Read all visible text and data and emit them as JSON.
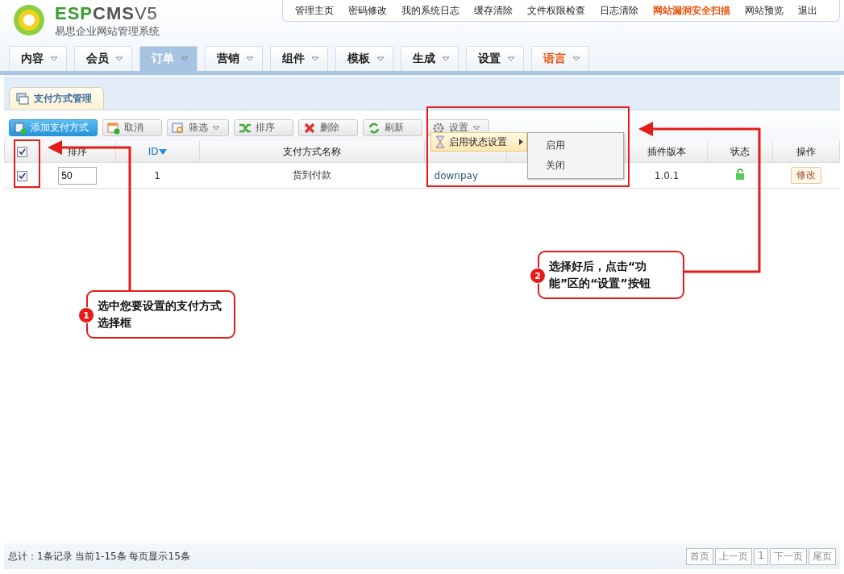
{
  "logo": {
    "wordmark_a": "ESP",
    "wordmark_b": "CMS",
    "version": "V5",
    "subtitle": "易思企业网站管理系统"
  },
  "top_links": [
    {
      "label": "管理主页",
      "highlight": false
    },
    {
      "label": "密码修改",
      "highlight": false
    },
    {
      "label": "我的系统日志",
      "highlight": false
    },
    {
      "label": "缓存清除",
      "highlight": false
    },
    {
      "label": "文件权限检查",
      "highlight": false
    },
    {
      "label": "日志清除",
      "highlight": false
    },
    {
      "label": "网站漏洞安全扫描",
      "highlight": true
    },
    {
      "label": "网站预览",
      "highlight": false
    },
    {
      "label": "退出",
      "highlight": false
    }
  ],
  "nav_tabs": [
    {
      "label": "内容",
      "selected": false,
      "highlight": false
    },
    {
      "label": "会员",
      "selected": false,
      "highlight": false
    },
    {
      "label": "订单",
      "selected": true,
      "highlight": false
    },
    {
      "label": "营销",
      "selected": false,
      "highlight": false
    },
    {
      "label": "组件",
      "selected": false,
      "highlight": false
    },
    {
      "label": "模板",
      "selected": false,
      "highlight": false
    },
    {
      "label": "生成",
      "selected": false,
      "highlight": false
    },
    {
      "label": "设置",
      "selected": false,
      "highlight": false
    },
    {
      "label": "语言",
      "selected": false,
      "highlight": true
    }
  ],
  "page_tab": {
    "label": "支付方式管理"
  },
  "toolbar": [
    {
      "label": "添加支付方式",
      "kind": "add",
      "primary": true,
      "caret": false
    },
    {
      "label": "取消",
      "kind": "cancel",
      "primary": false,
      "caret": false
    },
    {
      "label": "筛选",
      "kind": "filter",
      "primary": false,
      "caret": true
    },
    {
      "label": "排序",
      "kind": "sort",
      "primary": false,
      "caret": false
    },
    {
      "label": "删除",
      "kind": "delete",
      "primary": false,
      "caret": false
    },
    {
      "label": "刷新",
      "kind": "refresh",
      "primary": false,
      "caret": false
    },
    {
      "label": "设置",
      "kind": "settings",
      "primary": false,
      "caret": true
    }
  ],
  "settings_menu": {
    "items": [
      {
        "label": "启用状态设置",
        "expanded": true,
        "children": [
          {
            "label": "启用"
          },
          {
            "label": "关闭"
          }
        ]
      }
    ]
  },
  "table": {
    "header_checked": true,
    "columns": [
      "排序",
      "ID",
      "支付方式名称",
      "",
      "",
      "插件版本",
      "状态",
      "操作"
    ],
    "rows": [
      {
        "checked": true,
        "sort": "50",
        "id": "1",
        "name": "货到付款",
        "code": "downpay",
        "version": "1.0.1",
        "unlocked": true,
        "action": "修改"
      }
    ]
  },
  "footer": {
    "summary": "总计：1条记录 当前1-15条 每页显示15条",
    "pager": [
      "首页",
      "上一页",
      "1",
      "下一页",
      "尾页"
    ]
  },
  "callouts": [
    {
      "number": "1",
      "text": "选中您要设置的支付方式选择框"
    },
    {
      "number": "2",
      "text": "选择好后，点击“功能”区的“设置”按钮"
    }
  ]
}
